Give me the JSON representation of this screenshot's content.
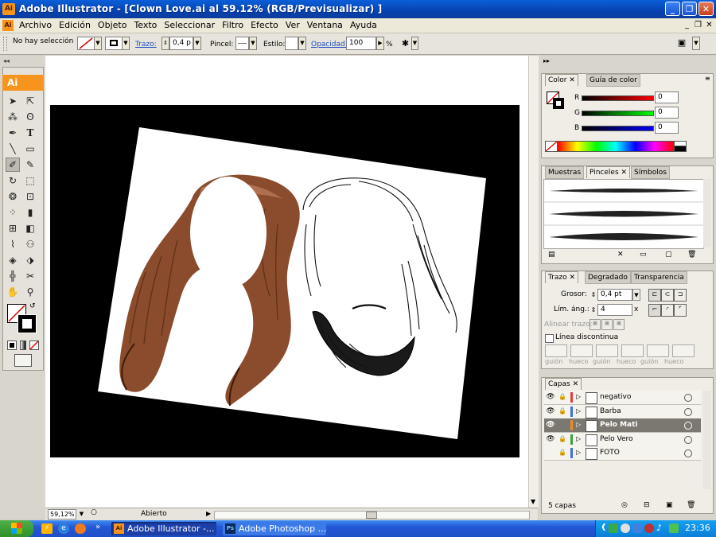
{
  "window": {
    "app_icon_label": "Ai",
    "title": "Adobe Illustrator - [Clown Love.ai al 59.12% (RGB/Previsualizar) ]"
  },
  "menu": {
    "items": [
      "Archivo",
      "Edición",
      "Objeto",
      "Texto",
      "Seleccionar",
      "Filtro",
      "Efecto",
      "Ver",
      "Ventana",
      "Ayuda"
    ]
  },
  "control": {
    "selection_status": "No hay selección",
    "trazo_label": "Trazo:",
    "trazo_value": "0,4 p",
    "pincel_label": "Pincel:",
    "estilo_label": "Estilo:",
    "opacidad_label": "Opacidad:",
    "opacidad_value": "100",
    "opacidad_unit": "%"
  },
  "toolbar": {
    "logo": "Ai"
  },
  "status": {
    "zoom": "59,12%",
    "state": "Abierto"
  },
  "color_panel": {
    "tab_color": "Color",
    "tab_guide": "Guía de color",
    "r_label": "R",
    "g_label": "G",
    "b_label": "B",
    "r_value": "0",
    "g_value": "0",
    "b_value": "0"
  },
  "brush_panel": {
    "tab_swatches": "Muestras",
    "tab_brushes": "Pinceles",
    "tab_symbols": "Símbolos"
  },
  "stroke_panel": {
    "tab_stroke": "Trazo",
    "tab_gradient": "Degradado",
    "tab_transparency": "Transparencia",
    "weight_label": "Grosor:",
    "weight_value": "0,4 pt",
    "limit_label": "Lím. áng.:",
    "limit_value": "4",
    "limit_unit": "x",
    "align_label": "Alinear trazo:",
    "dashed_label": "Línea discontinua",
    "dash_labels": [
      "guión",
      "hueco",
      "guión",
      "hueco",
      "guión",
      "hueco"
    ]
  },
  "layers_panel": {
    "tab": "Capas",
    "layers": [
      {
        "name": "negativo",
        "color": "#e03c3c",
        "visible": true,
        "selected": false
      },
      {
        "name": "Barba",
        "color": "#3c6ee0",
        "visible": true,
        "selected": false
      },
      {
        "name": "Pelo Mati",
        "color": "#f08a1e",
        "visible": true,
        "selected": true
      },
      {
        "name": "Pelo Vero",
        "color": "#3ca03c",
        "visible": true,
        "selected": false
      },
      {
        "name": "FOTO",
        "color": "#3c6ee0",
        "visible": false,
        "selected": false
      }
    ],
    "count": "5 capas"
  },
  "taskbar": {
    "items": [
      "Adobe Illustrator -...",
      "Adobe Photoshop ..."
    ],
    "clock": "23:36"
  }
}
